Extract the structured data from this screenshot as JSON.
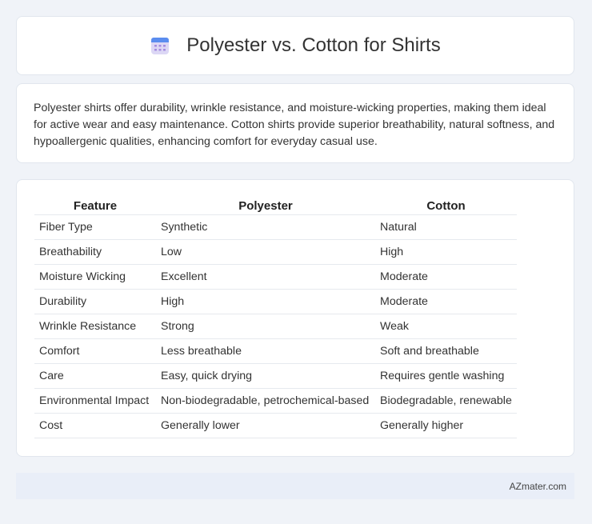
{
  "header": {
    "title": "Polyester vs. Cotton for Shirts",
    "icon": "calendar-icon"
  },
  "summary": {
    "text": "Polyester shirts offer durability, wrinkle resistance, and moisture-wicking properties, making them ideal for active wear and easy maintenance. Cotton shirts provide superior breathability, natural softness, and hypoallergenic qualities, enhancing comfort for everyday casual use."
  },
  "table": {
    "headers": [
      "Feature",
      "Polyester",
      "Cotton"
    ],
    "rows": [
      [
        "Fiber Type",
        "Synthetic",
        "Natural"
      ],
      [
        "Breathability",
        "Low",
        "High"
      ],
      [
        "Moisture Wicking",
        "Excellent",
        "Moderate"
      ],
      [
        "Durability",
        "High",
        "Moderate"
      ],
      [
        "Wrinkle Resistance",
        "Strong",
        "Weak"
      ],
      [
        "Comfort",
        "Less breathable",
        "Soft and breathable"
      ],
      [
        "Care",
        "Easy, quick drying",
        "Requires gentle washing"
      ],
      [
        "Environmental Impact",
        "Non-biodegradable, petrochemical-based",
        "Biodegradable, renewable"
      ],
      [
        "Cost",
        "Generally lower",
        "Generally higher"
      ]
    ]
  },
  "footer": {
    "brand": "AZmater.com"
  }
}
